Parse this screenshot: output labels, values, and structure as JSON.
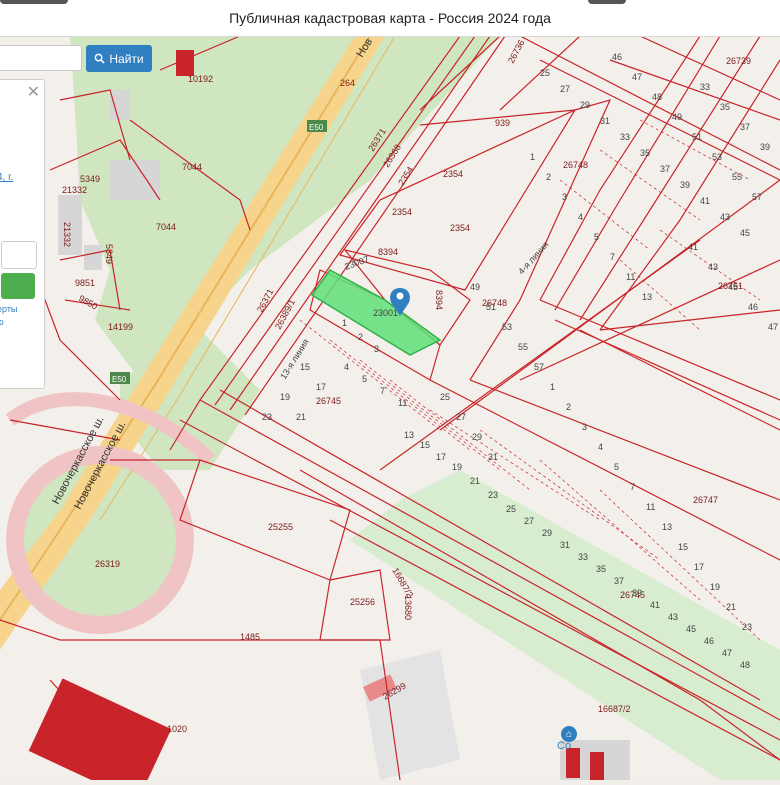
{
  "window": {
    "title": "Публичная кадастровая карта - Россия 2024 года"
  },
  "search": {
    "placeholder": "",
    "button_label": "Найти"
  },
  "info_panel": {
    "link_fragment": "4, г.",
    "text_line1": "ерты",
    "text_line2": "ю"
  },
  "map": {
    "highlighted_parcel": "23001",
    "roads": {
      "novocherkasskoe_1": "Новочеркасское ш.",
      "novocherkasskoe_2": "Новочеркасское ш.",
      "e50_top": "E50",
      "e50_bottom": "E50",
      "nov_top": "Нов",
      "line_13": "13-я линия",
      "line_4": "4-я линия"
    },
    "poi_label": "Со",
    "cadastral_numbers": {
      "n26371": "26371",
      "n26368": "26368",
      "n2354a": "2354",
      "n2354b": "2354",
      "n2354c": "2354",
      "n2354d": "2354",
      "n939": "939",
      "n26748a": "26748",
      "n26748b": "26748",
      "n8394a": "8394",
      "n8394b": "8394",
      "n23007": "23007",
      "n26371b": "26371",
      "n26389": "26389/1",
      "n264": "264",
      "n10192": "10192",
      "n7044a": "7044",
      "n7044b": "7044",
      "n5349a": "5349",
      "n5349b": "5349",
      "n21332a": "21332",
      "n21332b": "21332",
      "n9851": "9851",
      "n9850": "9850",
      "n14199": "14199",
      "n26745a": "26745",
      "n26745b": "26745",
      "n25255": "25255",
      "n16687a": "16687/2",
      "n16687b": "16687/2",
      "n13680": "13680",
      "n25256": "25256",
      "n26319": "26319",
      "n1485": "1485",
      "n1020": "1020",
      "n26299": "26299",
      "n26739": "26739",
      "n26751": "26751",
      "n26747": "26747",
      "n26736": "26736"
    },
    "lot_numbers": [
      "1",
      "2",
      "3",
      "4",
      "5",
      "7",
      "11",
      "13",
      "15",
      "17",
      "19",
      "21",
      "23",
      "25",
      "27",
      "29",
      "31",
      "33",
      "35",
      "37",
      "39",
      "41",
      "43",
      "45",
      "46",
      "47",
      "48",
      "49",
      "51",
      "53",
      "55",
      "57"
    ]
  }
}
